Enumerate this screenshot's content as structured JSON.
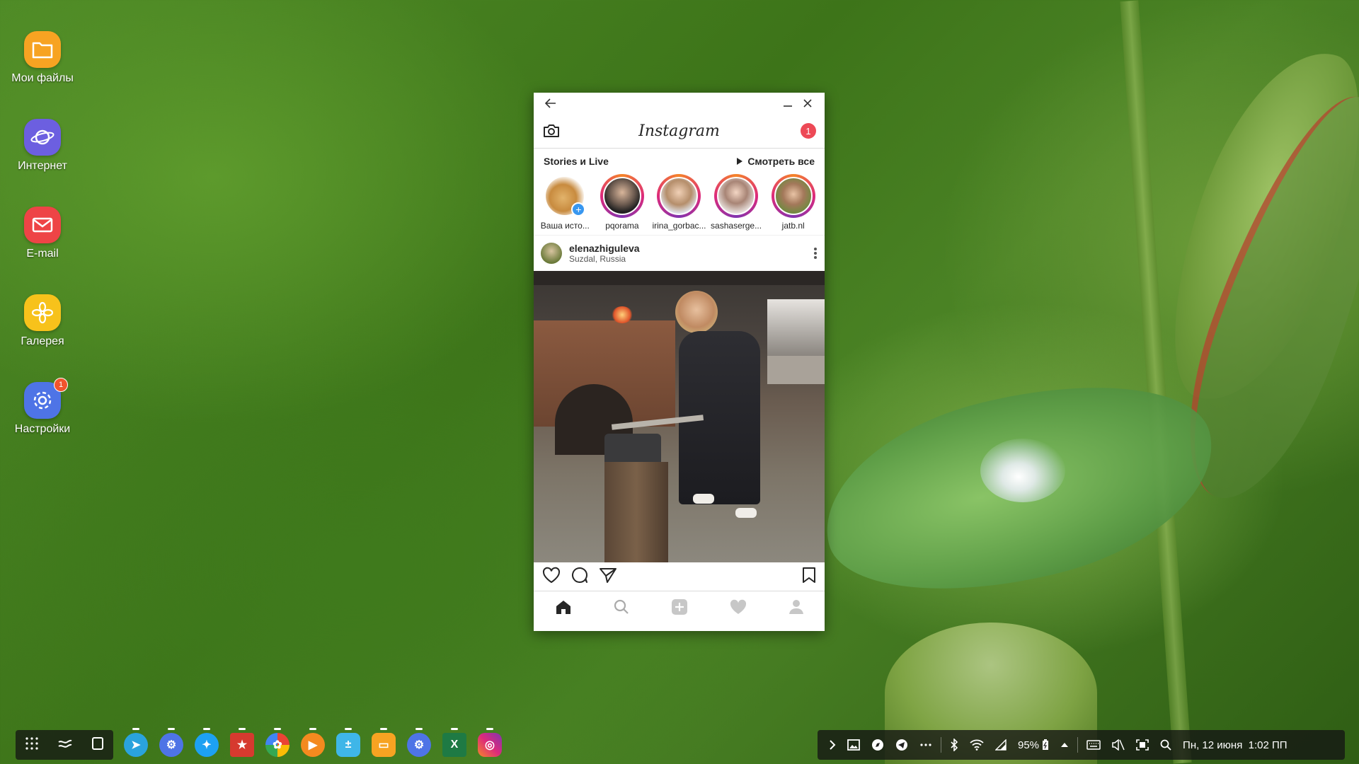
{
  "desktop": {
    "icons": [
      {
        "label": "Мои файлы",
        "color": "#f7a322",
        "icon": "folder-icon"
      },
      {
        "label": "Интернет",
        "color": "#6c5fe0",
        "icon": "planet-icon"
      },
      {
        "label": "E-mail",
        "color": "#ee4446",
        "icon": "mail-icon"
      },
      {
        "label": "Галерея",
        "color": "#f7c21b",
        "icon": "flower-icon"
      },
      {
        "label": "Настройки",
        "color": "#4e74e6",
        "icon": "gear-icon",
        "badge": "1"
      }
    ]
  },
  "window": {
    "app_title": "Instagram",
    "notification_count": "1",
    "stories_title": "Stories и Live",
    "see_all": "Смотреть все",
    "stories": [
      {
        "name": "Ваша исто...",
        "own": true
      },
      {
        "name": "pqorama"
      },
      {
        "name": "irina_gorbac..."
      },
      {
        "name": "sashaserge..."
      },
      {
        "name": "jatb.nl"
      }
    ],
    "post": {
      "user": "elenazhiguleva",
      "location": "Suzdal, Russia"
    }
  },
  "taskbar": {
    "dock_apps": [
      {
        "icon": "telegram-icon",
        "color": "#2aa3dd"
      },
      {
        "icon": "settings-icon",
        "color": "#4e74e6"
      },
      {
        "icon": "twitter-icon",
        "color": "#1da1f2"
      },
      {
        "icon": "wunderlist-icon",
        "color": "#d63a2f"
      },
      {
        "icon": "google-photos-icon",
        "color": "#ffffff"
      },
      {
        "icon": "play-music-icon",
        "color": "#f48a1f"
      },
      {
        "icon": "calculator-icon",
        "color": "#3fb6e8"
      },
      {
        "icon": "my-files-icon",
        "color": "#f7a322"
      },
      {
        "icon": "settings-icon",
        "color": "#4e74e6"
      },
      {
        "icon": "excel-icon",
        "color": "#1e7a44"
      },
      {
        "icon": "instagram-icon",
        "color": "#d6366f"
      }
    ],
    "battery": "95%",
    "datetime": "Пн, 12 июня  1:02 ПП"
  }
}
